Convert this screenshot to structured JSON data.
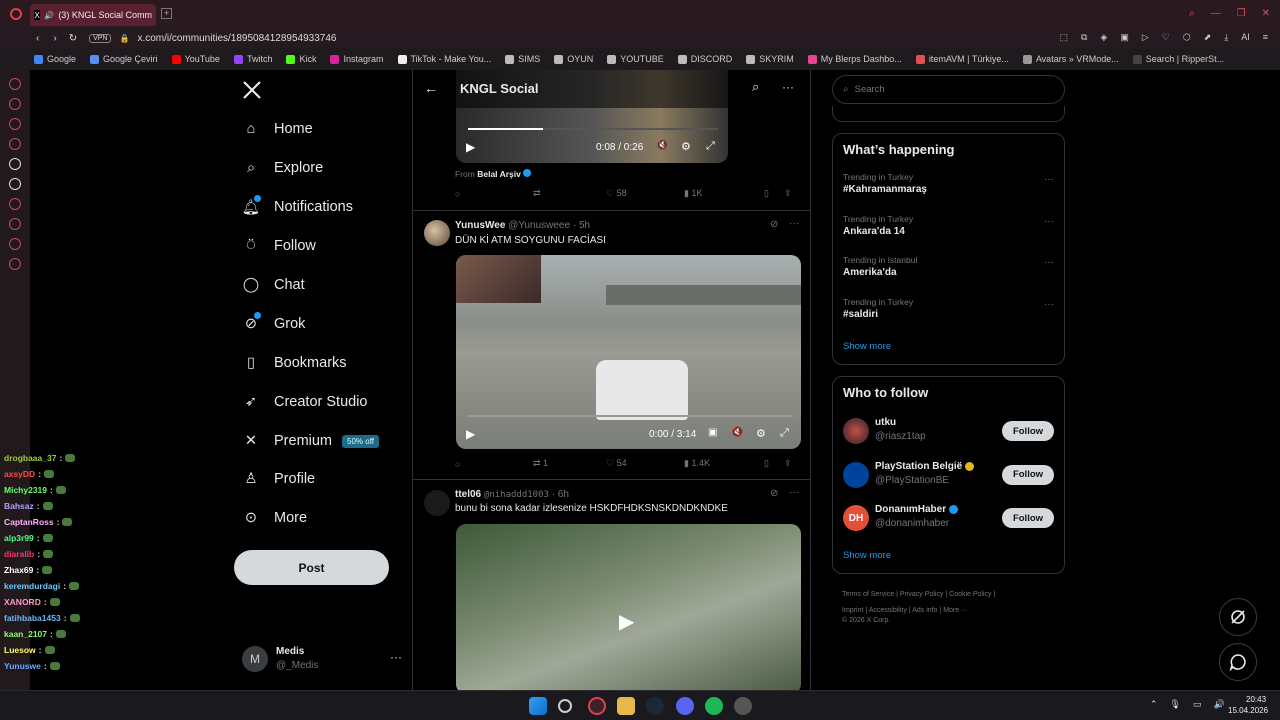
{
  "browser": {
    "tab_title": "(3) KNGL Social Comm",
    "url": "x.com/i/communities/1895084128954933746",
    "vpn_label": "VPN",
    "ai_label": "AI",
    "bookmarks": [
      {
        "label": "Google",
        "color": "#4285f4"
      },
      {
        "label": "Google Çeviri",
        "color": "#5a8ef0"
      },
      {
        "label": "YouTube",
        "color": "#ff0000"
      },
      {
        "label": "Twitch",
        "color": "#9146ff"
      },
      {
        "label": "Kick",
        "color": "#53fc18"
      },
      {
        "label": "Instagram",
        "color": "#d6249f"
      },
      {
        "label": "TikTok - Make You...",
        "color": "#eeeeee"
      },
      {
        "label": "SIMS",
        "color": "#bbbbbb"
      },
      {
        "label": "OYUN",
        "color": "#bbbbbb"
      },
      {
        "label": "YOUTUBE",
        "color": "#bbbbbb"
      },
      {
        "label": "DISCORD",
        "color": "#bbbbbb"
      },
      {
        "label": "SKYRIM",
        "color": "#bbbbbb"
      },
      {
        "label": "My Blerps Dashbo...",
        "color": "#e84393"
      },
      {
        "label": "itemAVM | Türkiye...",
        "color": "#e05050"
      },
      {
        "label": "Avatars » VRMode...",
        "color": "#999999"
      },
      {
        "label": "Search | RipperSt...",
        "color": "#444444"
      }
    ]
  },
  "nav": {
    "items": [
      {
        "label": "Home",
        "icon": "home-icon"
      },
      {
        "label": "Explore",
        "icon": "search-icon"
      },
      {
        "label": "Notifications",
        "icon": "bell-icon"
      },
      {
        "label": "Follow",
        "icon": "add-person-icon"
      },
      {
        "label": "Chat",
        "icon": "chat-icon"
      },
      {
        "label": "Grok",
        "icon": "grok-icon"
      },
      {
        "label": "Bookmarks",
        "icon": "bookmark-icon"
      },
      {
        "label": "Creator Studio",
        "icon": "rocket-icon"
      },
      {
        "label": "Premium",
        "icon": "x-logo-icon"
      },
      {
        "label": "Profile",
        "icon": "person-icon"
      },
      {
        "label": "More",
        "icon": "more-circle-icon"
      }
    ],
    "premium_badge": "50% off",
    "post_label": "Post",
    "account": {
      "initial": "M",
      "name": "Medis",
      "handle": "@_Medis"
    }
  },
  "header": {
    "title": "KNGL Social"
  },
  "posts": [
    {
      "video_time": "0:08 / 0:26",
      "from_label": "From",
      "from_name": "Belal Arşiv",
      "replies": "",
      "reposts": "",
      "likes": "58",
      "views": "1K"
    },
    {
      "author": "YunusWee",
      "handle": "@Yunusweee",
      "time": "5h",
      "text": "DÜN Kİ ATM SOYGUNU FACİASI",
      "video_time": "0:00 / 3:14",
      "replies": "",
      "reposts": "1",
      "likes": "54",
      "views": "1.4K"
    },
    {
      "author": "ttel06",
      "handle": "@nihaddd1003",
      "time": "6h",
      "text": "bunu bi sona kadar izlesenize HSKDFHDKSNSKDNDKNDKE"
    }
  ],
  "search": {
    "placeholder": "Search"
  },
  "trending": {
    "title": "What’s happening",
    "items": [
      {
        "context": "Trending in Turkey",
        "name": "#Kahramanmaraş"
      },
      {
        "context": "Trending in Turkey",
        "name": "Ankara'da 14"
      },
      {
        "context": "Trending in Istanbul",
        "name": "Amerika'da"
      },
      {
        "context": "Trending in Turkey",
        "name": "#saldiri"
      }
    ],
    "show_more": "Show more"
  },
  "who_to_follow": {
    "title": "Who to follow",
    "users": [
      {
        "name": "utku",
        "handle": "@riasz1tap",
        "verified": false
      },
      {
        "name": "PlayStation België",
        "handle": "@PlayStationBE",
        "verified": true
      },
      {
        "name": "DonanımHaber",
        "handle": "@donanimhaber",
        "verified": true,
        "initials": "DH"
      }
    ],
    "follow_label": "Follow",
    "show_more": "Show more"
  },
  "footer": {
    "links": [
      "Terms of Service",
      "Privacy Policy",
      "Cookie Policy",
      "Imprint",
      "Accessibility",
      "Ads info",
      "More ···"
    ],
    "copyright": "© 2026 X Corp."
  },
  "chat": [
    {
      "user": "drogbaaa_37",
      "color": "#9acd32"
    },
    {
      "user": "axsyDD",
      "color": "#ff4a4a"
    },
    {
      "user": "Michy2319",
      "color": "#66ff66"
    },
    {
      "user": "Bahsaz",
      "color": "#b0a0ff"
    },
    {
      "user": "CaptanRoss",
      "color": "#ffb0ff"
    },
    {
      "user": "alp3r99",
      "color": "#4dff88"
    },
    {
      "user": "diaralib",
      "color": "#ff3366"
    },
    {
      "user": "Zhax69",
      "color": "#ffffff"
    },
    {
      "user": "keremdurdagi",
      "color": "#66ccff"
    },
    {
      "user": "XANORD",
      "color": "#ff99cc"
    },
    {
      "user": "fatihbaba1453",
      "color": "#66bbff"
    },
    {
      "user": "kaan_2107",
      "color": "#88ff66"
    },
    {
      "user": "Luesow",
      "color": "#ffff66"
    },
    {
      "user": "Yunuswe",
      "color": "#66aaff"
    }
  ],
  "taskbar": {
    "time": "20:43",
    "date": "15.04.2026"
  },
  "colors": {
    "accent": "#1d9bf0",
    "opera_red": "#c84a5a"
  }
}
